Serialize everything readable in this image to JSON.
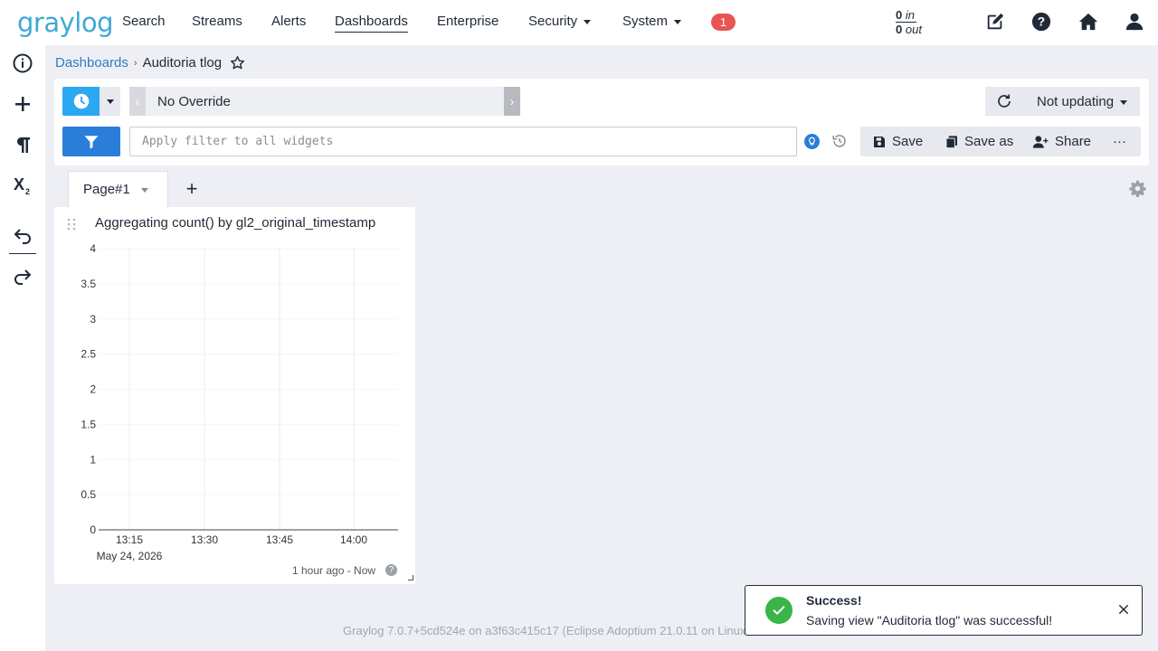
{
  "app": {
    "logo": "graylog"
  },
  "nav": {
    "items": [
      {
        "label": "Search"
      },
      {
        "label": "Streams"
      },
      {
        "label": "Alerts"
      },
      {
        "label": "Dashboards"
      },
      {
        "label": "Enterprise"
      },
      {
        "label": "Security"
      },
      {
        "label": "System"
      }
    ],
    "notifications": "1",
    "throughput_in_value": "0",
    "throughput_in_label": "in",
    "throughput_out_value": "0",
    "throughput_out_label": "out"
  },
  "sidebar": {
    "icons": [
      "info-icon",
      "plus-icon",
      "paragraph-icon",
      "subscript-icon",
      "undo-icon",
      "redo-icon"
    ]
  },
  "breadcrumb": {
    "parent": "Dashboards",
    "current": "Auditoria tlog"
  },
  "searchbar": {
    "time_range": "No Override",
    "refresh": "Not updating",
    "filter_placeholder": "Apply filter to all widgets",
    "save": "Save",
    "save_as": "Save as",
    "share": "Share",
    "more": "···"
  },
  "pages": {
    "tab": "Page#1"
  },
  "widget": {
    "title": "Aggregating count() by gl2_original_timestamp",
    "footer": "1 hour ago - Now",
    "help": "?"
  },
  "chart_data": {
    "type": "line",
    "title": "",
    "xlabel": "",
    "ylabel": "",
    "y_ticks": [
      "0",
      "0.5",
      "1",
      "1.5",
      "2",
      "2.5",
      "3",
      "3.5",
      "4"
    ],
    "ylim": [
      0,
      4
    ],
    "x_ticks": [
      "13:15",
      "13:30",
      "13:45",
      "14:00"
    ],
    "x_subtitle": "May 24, 2026",
    "series": []
  },
  "footer": {
    "text": "Graylog 7.0.7+5cd524e on a3f63c415c17 (Eclipse Adoptium 21.0.11 on Linux"
  },
  "toast": {
    "title": "Success!",
    "message": "Saving view \"Auditoria tlog\" was successful!"
  }
}
